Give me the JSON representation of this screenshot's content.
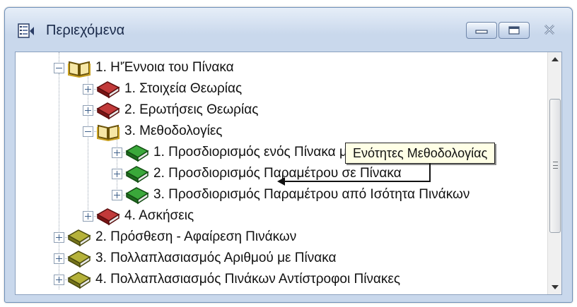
{
  "window": {
    "title": "Περιεχόμενα",
    "minimize_icon": "minimize-icon",
    "maximize_icon": "maximize-icon",
    "close_icon": "close-icon",
    "frame_color": "#c9d8ec"
  },
  "tree": {
    "items": [
      {
        "level": 0,
        "expanded": true,
        "icon": "open-book-icon",
        "book_color": "#c8a020",
        "label": "1. Η'Έννοια του Πίνακα"
      },
      {
        "level": 1,
        "expanded": false,
        "icon": "red-book-icon",
        "book_color": "#9a1e1e",
        "label": "1. Στοιχεία Θεωρίας"
      },
      {
        "level": 1,
        "expanded": false,
        "icon": "red-book-icon",
        "book_color": "#9a1e1e",
        "label": "2. Ερωτήσεις Θεωρίας"
      },
      {
        "level": 1,
        "expanded": true,
        "icon": "open-book-icon",
        "book_color": "#c8a020",
        "label": "3. Μεθοδολογίες"
      },
      {
        "level": 2,
        "expanded": false,
        "icon": "green-book-icon",
        "book_color": "#2f8a2f",
        "label": "1. Προσδιορισμός ενός Πίνακα μxν"
      },
      {
        "level": 2,
        "expanded": false,
        "icon": "green-book-icon",
        "book_color": "#2f8a2f",
        "label": "2. Προσδιορισμός Παραμέτρου σε Πίνακα"
      },
      {
        "level": 2,
        "expanded": false,
        "icon": "green-book-icon",
        "book_color": "#2f8a2f",
        "label": "3. Προσδιορισμός Παραμέτρου από Ισότητα Πινάκων"
      },
      {
        "level": 1,
        "expanded": false,
        "icon": "red-book-icon",
        "book_color": "#9a1e1e",
        "label": "4. Ασκήσεις"
      },
      {
        "level": 0,
        "expanded": false,
        "icon": "olive-book-icon",
        "book_color": "#8c8a1e",
        "label": "2. Πρόσθεση - Αφαίρεση Πινάκων"
      },
      {
        "level": 0,
        "expanded": false,
        "icon": "olive-book-icon",
        "book_color": "#8c8a1e",
        "label": "3. Πολλαπλασιασμός Αριθμού με Πίνακα"
      },
      {
        "level": 0,
        "expanded": false,
        "icon": "olive-book-icon",
        "book_color": "#8c8a1e",
        "label": "4. Πολλαπλασιασμός Πινάκων Αντίστροφοι Πίνακες"
      }
    ]
  },
  "tooltip": {
    "text": "Ενότητες Μεθοδολογίας"
  },
  "scrollbar": {
    "up_icon": "scroll-up-arrow-icon",
    "down_icon": "scroll-down-arrow-icon"
  }
}
